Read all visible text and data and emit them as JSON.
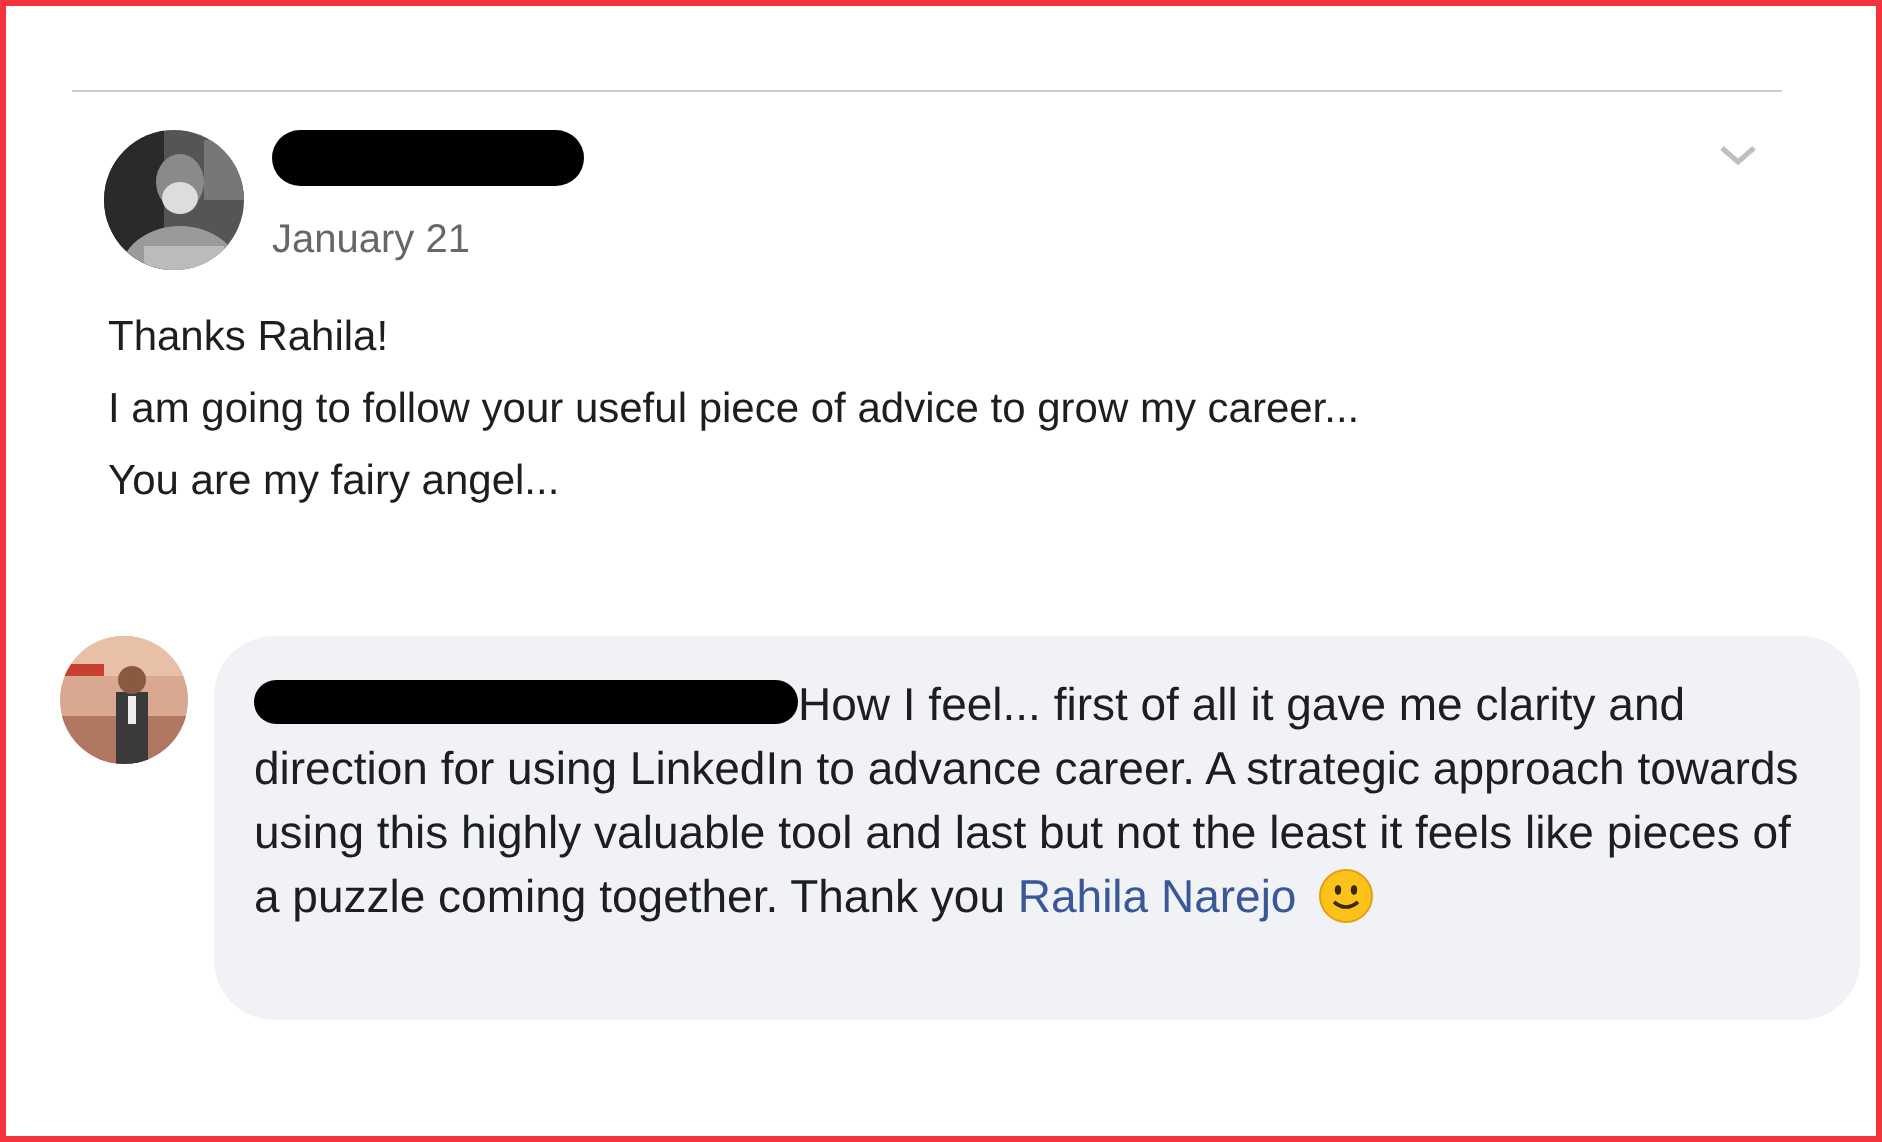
{
  "post": {
    "date": "January 21",
    "body": [
      "Thanks Rahila!",
      "I am going to follow your useful piece of advice to grow my career...",
      "You are my fairy angel..."
    ]
  },
  "comment": {
    "text": "How I feel... first of all it gave me clarity and direction for using LinkedIn to advance career. A strategic approach towards using this highly valuable tool and last but not the least it feels like pieces of a puzzle coming together. Thank you",
    "mention": "Rahila Narejo"
  }
}
